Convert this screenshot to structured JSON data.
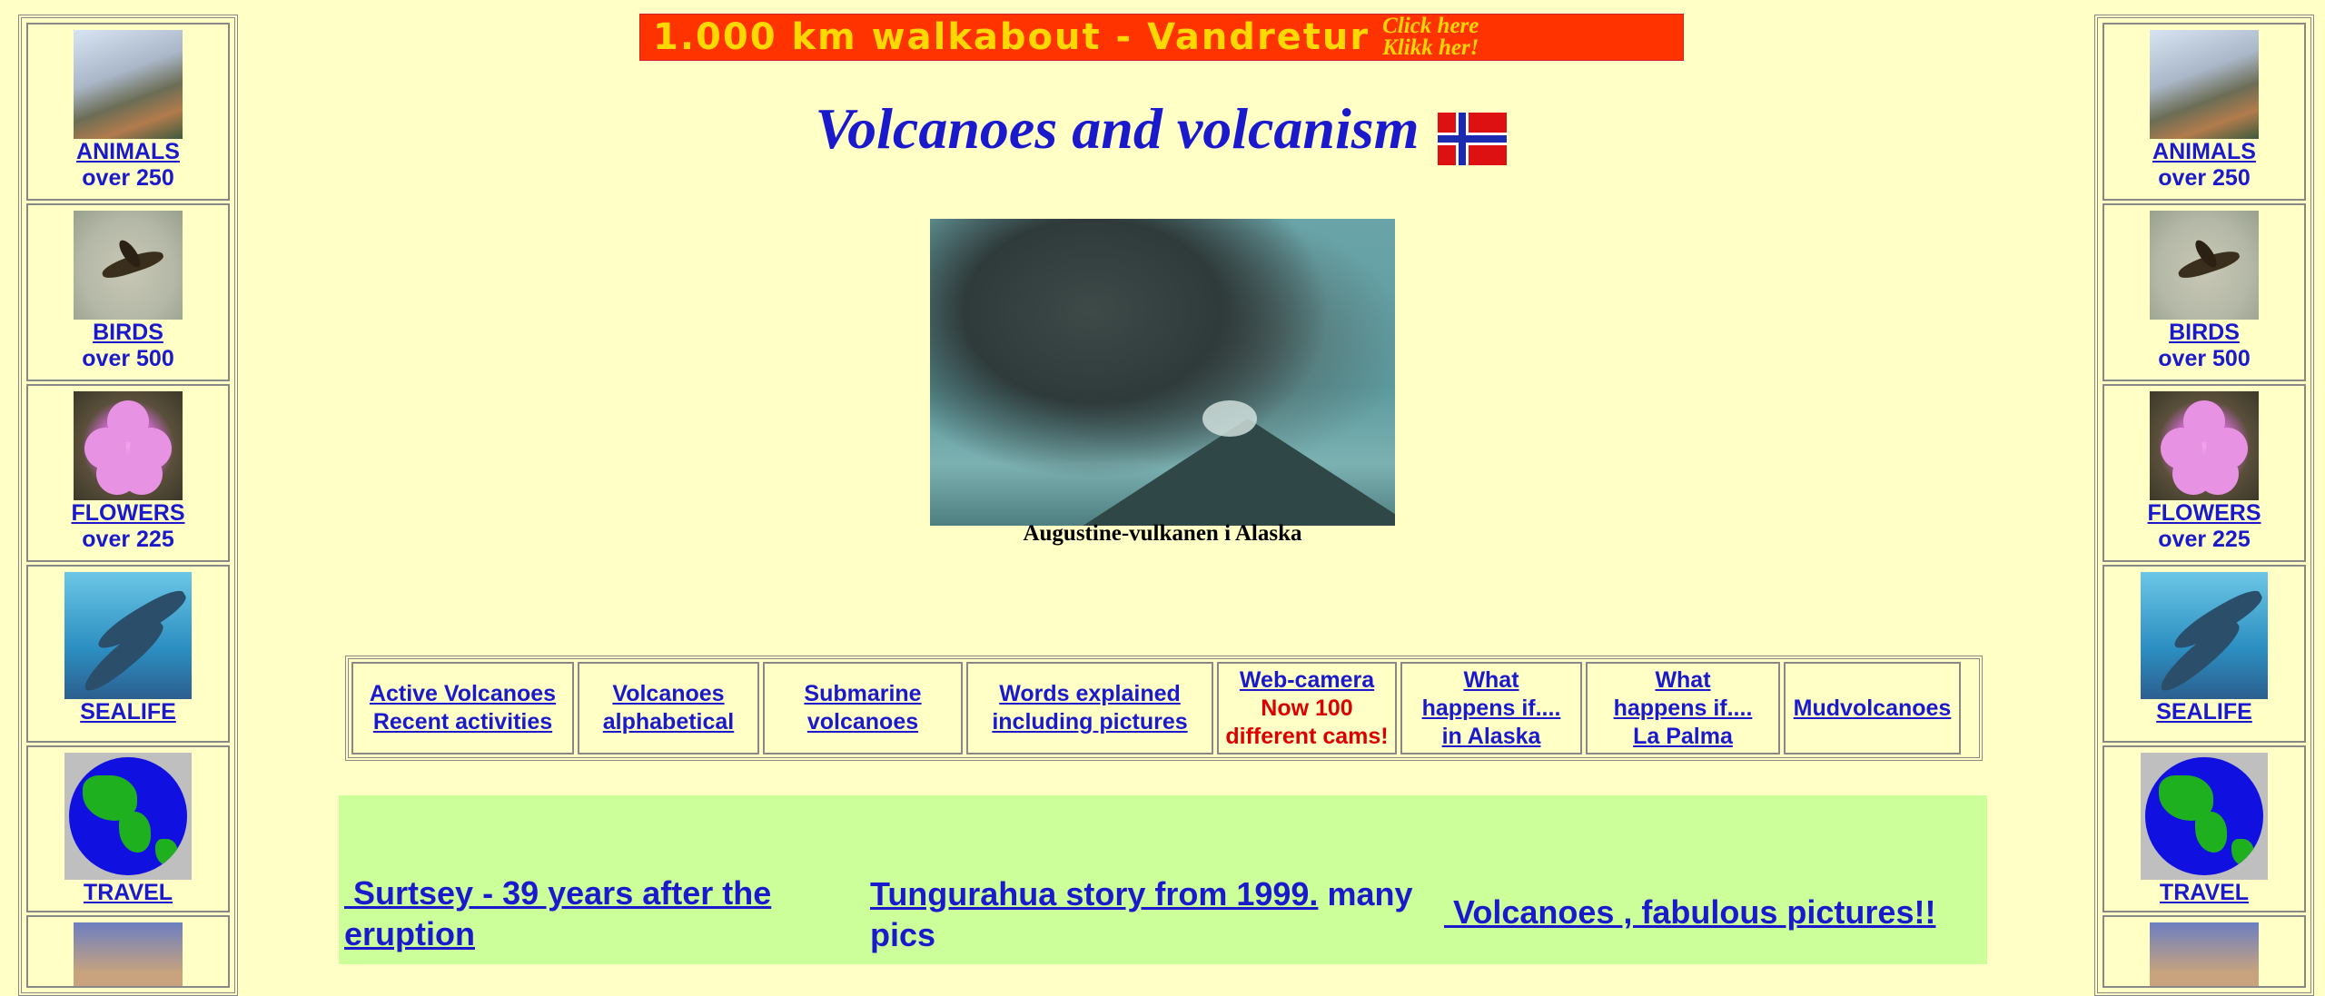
{
  "banner": {
    "text": "1.000 km walkabout - Vandretur",
    "click_line1": "Click here",
    "click_line2": "Klikk her!"
  },
  "page": {
    "title": "Volcanoes and volcanism",
    "photo_caption": "Augustine-vulkanen i Alaska"
  },
  "sidebar": [
    {
      "label": "ANIMALS",
      "sub": "over 250",
      "icon": "animals-thumbnail"
    },
    {
      "label": "BIRDS",
      "sub": "over 500",
      "icon": "bird-thumbnail"
    },
    {
      "label": "FLOWERS",
      "sub": "over 225",
      "icon": "flower-thumbnail"
    },
    {
      "label": "SEALIFE",
      "sub": "",
      "icon": "dolphin-thumbnail"
    },
    {
      "label": "TRAVEL",
      "sub": "",
      "icon": "globe-icon"
    }
  ],
  "nav": [
    {
      "line1": "Active Volcanoes",
      "line2": "Recent activities"
    },
    {
      "line1": "Volcanoes",
      "line2": "alphabetical"
    },
    {
      "line1": "Submarine",
      "line2": "volcanoes"
    },
    {
      "line1": "Words explained",
      "line2": "including pictures"
    },
    {
      "line1": "Web-camera",
      "line2": "Now 100",
      "line3": "different cams!"
    },
    {
      "line1": "What",
      "line2": "happens if....",
      "line3": "in Alaska"
    },
    {
      "line1": "What",
      "line2": "happens if....",
      "line3": "La Palma"
    },
    {
      "line1": "Mudvolcanoes"
    }
  ],
  "featured": {
    "surtsey_line1": "Surtsey - 39 years after the",
    "surtsey_line2": "eruption",
    "tungurahua_link": "Tungurahua story from 1999.",
    "tungurahua_rest1": "many",
    "tungurahua_rest2": "pics",
    "fabulous": "Volcanoes , fabulous pictures!!"
  },
  "colors": {
    "background": "#ffffc6",
    "link": "#1a1acc",
    "banner": "#ff3300",
    "green_section": "#ccff99",
    "webcam_red": "#dd0000"
  }
}
